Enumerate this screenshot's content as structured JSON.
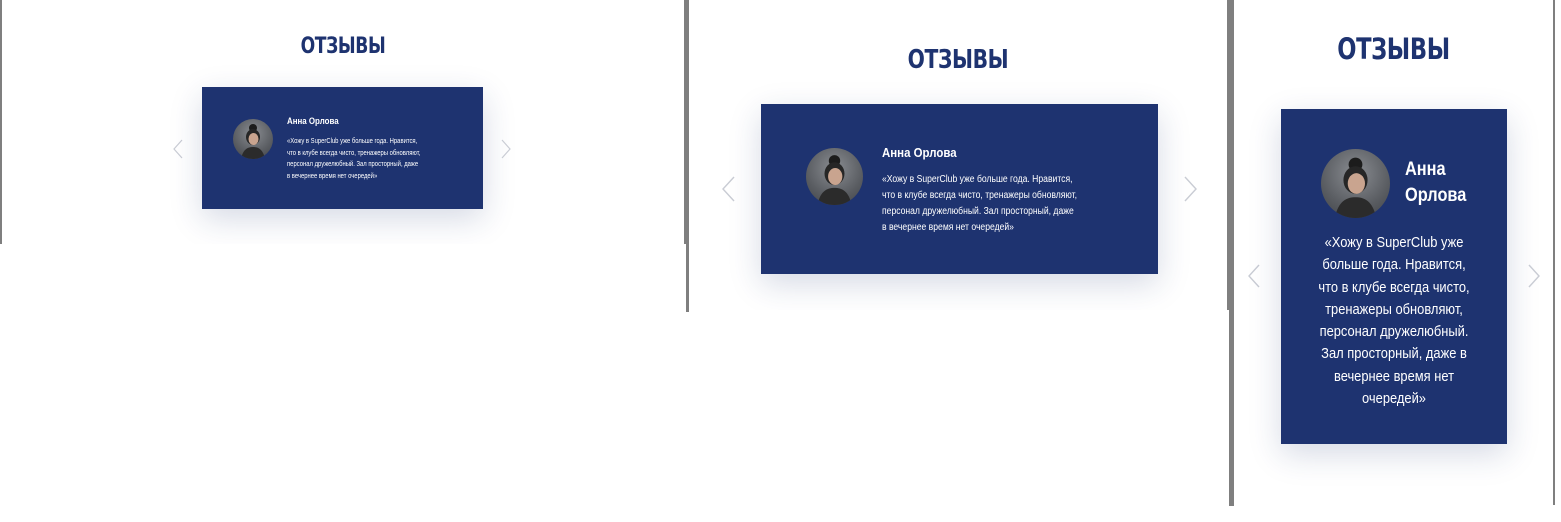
{
  "section_title": "ОТЗЫВЫ",
  "review": {
    "name": "Анна Орлова",
    "name_line1": "Анна",
    "name_line2": "Орлова",
    "quote": "«Хожу в SuperClub уже больше года. Нравится, что в клубе всегда чисто, тренажеры обновляют, персонал дружелюбный. Зал просторный, даже в вечернее время нет очередей»",
    "quote_lines_wide": [
      "«Хожу в SuperClub уже больше года. Нравится,",
      "что в клубе всегда чисто, тренажеры обновляют,",
      "персонал дружелюбный. Зал просторный, даже",
      "в вечернее время нет очередей»"
    ],
    "quote_lines_narrow": [
      "«Хожу в SuperClub уже",
      "больше года. Нравится,",
      "что в клубе всегда чисто,",
      "тренажеры обновляют,",
      "персонал дружелюбный.",
      "Зал просторный, даже в",
      "вечернее время нет",
      "очередей»"
    ]
  },
  "colors": {
    "brand_navy": "#1e3370",
    "arrow_gray": "#c9ccd4",
    "divider_gray": "#7f7f7f"
  },
  "icons": {
    "prev": "chevron-left-icon",
    "next": "chevron-right-icon",
    "avatar": "user-photo"
  }
}
